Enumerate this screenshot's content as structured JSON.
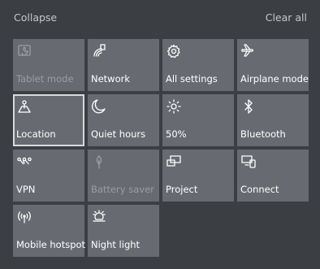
{
  "header": {
    "collapse_label": "Collapse",
    "clear_label": "Clear all"
  },
  "tiles": [
    {
      "label": "Tablet mode",
      "icon": "tablet-mode-icon",
      "state": "disabled"
    },
    {
      "label": "Network",
      "icon": "network-icon",
      "state": "normal"
    },
    {
      "label": "All settings",
      "icon": "gear-icon",
      "state": "normal"
    },
    {
      "label": "Airplane mode",
      "icon": "airplane-icon",
      "state": "normal"
    },
    {
      "label": "Location",
      "icon": "location-icon",
      "state": "focused"
    },
    {
      "label": "Quiet hours",
      "icon": "moon-icon",
      "state": "normal"
    },
    {
      "label": "50%",
      "icon": "brightness-icon",
      "state": "normal"
    },
    {
      "label": "Bluetooth",
      "icon": "bluetooth-icon",
      "state": "normal"
    },
    {
      "label": "VPN",
      "icon": "vpn-icon",
      "state": "normal"
    },
    {
      "label": "Battery saver",
      "icon": "battery-saver-icon",
      "state": "disabled"
    },
    {
      "label": "Project",
      "icon": "project-icon",
      "state": "normal"
    },
    {
      "label": "Connect",
      "icon": "connect-icon",
      "state": "normal"
    },
    {
      "label": "Mobile hotspot",
      "icon": "mobile-hotspot-icon",
      "state": "normal"
    },
    {
      "label": "Night light",
      "icon": "night-light-icon",
      "state": "normal"
    }
  ]
}
